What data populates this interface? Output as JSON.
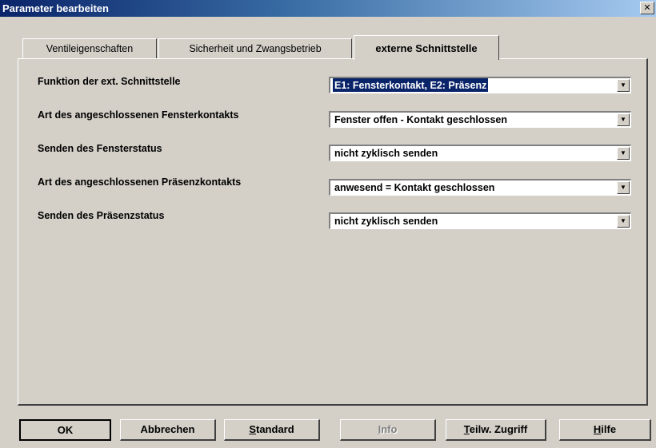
{
  "window": {
    "title": "Parameter bearbeiten",
    "close_glyph": "✕"
  },
  "tabs": [
    {
      "label": "Ventileigenschaften",
      "active": false
    },
    {
      "label": "Sicherheit und Zwangsbetrieb",
      "active": false
    },
    {
      "label": "externe Schnittstelle",
      "active": true
    }
  ],
  "params": [
    {
      "label": "Funktion der ext. Schnittstelle",
      "value": "E1: Fensterkontakt, E2: Präsenz",
      "focused": true
    },
    {
      "label": "Art des angeschlossenen Fensterkontakts",
      "value": "Fenster offen - Kontakt geschlossen"
    },
    {
      "label": "Senden des Fensterstatus",
      "value": "nicht zyklisch senden"
    },
    {
      "label": "Art des angeschlossenen Präsenzkontakts",
      "value": "anwesend = Kontakt geschlossen"
    },
    {
      "label": "Senden des Präsenzstatus",
      "value": "nicht zyklisch senden"
    }
  ],
  "buttons": {
    "ok": "OK",
    "cancel": "Abbrechen",
    "standard_first": "S",
    "standard_rest": "tandard",
    "info_first": "I",
    "info_rest": "nfo",
    "access_first": "T",
    "access_rest": "eilw. Zugriff",
    "help_first": "H",
    "help_rest": "ilfe"
  },
  "icons": {
    "dropdown_arrow": "▼"
  }
}
